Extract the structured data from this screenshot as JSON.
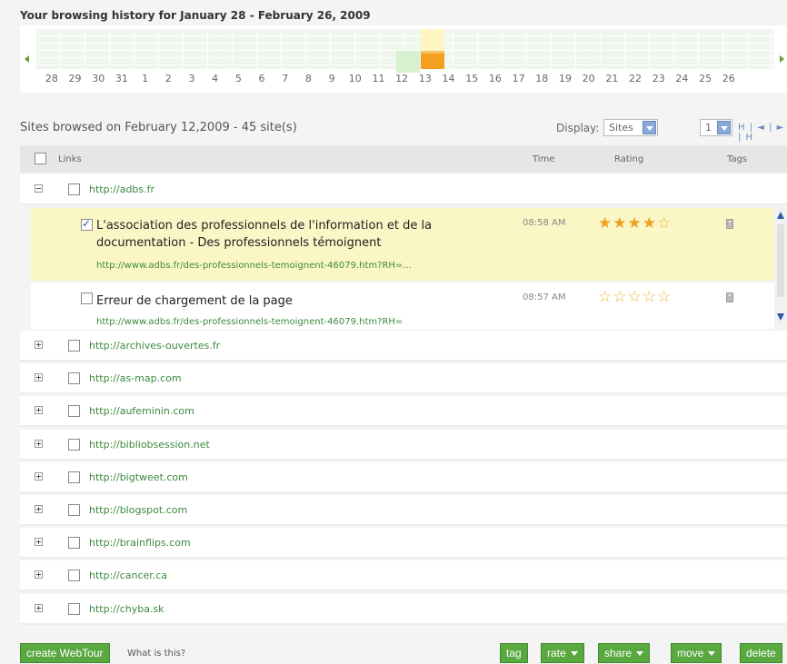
{
  "history": {
    "title": "Your browsing history for January 28 - February 26, 2009",
    "days": [
      "28",
      "29",
      "30",
      "31",
      "1",
      "2",
      "3",
      "4",
      "5",
      "6",
      "7",
      "8",
      "9",
      "10",
      "11",
      "12",
      "13",
      "14",
      "15",
      "16",
      "17",
      "18",
      "19",
      "20",
      "21",
      "22",
      "23",
      "24",
      "25",
      "26"
    ],
    "highlight_color": "#f3a020"
  },
  "sites": {
    "title": "Sites browsed on February 12,2009 - 45 site(s)",
    "display_label": "Display:",
    "display_value": "Sites",
    "page_value": "1",
    "pager_nav": "H | ◄ | ► | H"
  },
  "columns": {
    "links": "Links",
    "time": "Time",
    "rating": "Rating",
    "tags": "Tags"
  },
  "expanded_site": {
    "url": "http://adbs.fr",
    "entries": [
      {
        "title": "L'association des professionnels de l'information et de la documentation - Des professionnels témoignent",
        "url": "http://www.adbs.fr/des-professionnels-temoignent-46079.htm?RH=...",
        "time": "08:58 AM",
        "stars_filled": "★★★★",
        "stars_empty": "☆",
        "rating": 4,
        "checked": true
      },
      {
        "title": "Erreur de chargement de la page",
        "url": "http://www.adbs.fr/des-professionnels-temoignent-46079.htm?RH=",
        "time": "08:57 AM",
        "stars_filled": "",
        "stars_empty": "☆☆☆☆☆",
        "rating": 0,
        "checked": false
      }
    ]
  },
  "collapsed_sites": [
    "http://archives-ouvertes.fr",
    "http://as-map.com",
    "http://aufeminin.com",
    "http://bibliobsession.net",
    "http://bigtweet.com",
    "http://blogspot.com",
    "http://brainflips.com",
    "http://cancer.ca",
    "http://chyba.sk"
  ],
  "footer": {
    "create_webtour": "create WebTour",
    "what_is_this": "What is this?",
    "tag": "tag",
    "rate": "rate",
    "share": "share",
    "move": "move",
    "delete": "delete"
  },
  "colors": {
    "accent_green": "#5aa840",
    "link_green": "#3d8a3d",
    "star_orange": "#f0a020",
    "highlight_row": "#fbf6c6"
  }
}
